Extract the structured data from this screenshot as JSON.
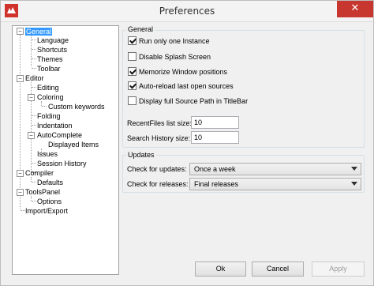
{
  "window": {
    "title": "Preferences",
    "close_glyph": "✕"
  },
  "tree": {
    "items": [
      {
        "label": "General",
        "selected": true
      },
      {
        "label": "Language"
      },
      {
        "label": "Shortcuts"
      },
      {
        "label": "Themes"
      },
      {
        "label": "Toolbar"
      },
      {
        "label": "Editor"
      },
      {
        "label": "Editing"
      },
      {
        "label": "Coloring"
      },
      {
        "label": "Custom keywords"
      },
      {
        "label": "Folding"
      },
      {
        "label": "Indentation"
      },
      {
        "label": "AutoComplete"
      },
      {
        "label": "Displayed Items"
      },
      {
        "label": "Issues"
      },
      {
        "label": "Session History"
      },
      {
        "label": "Compiler"
      },
      {
        "label": "Defaults"
      },
      {
        "label": "ToolsPanel"
      },
      {
        "label": "Options"
      },
      {
        "label": "Import/Export"
      }
    ],
    "expander_glyph": "−"
  },
  "general": {
    "title": "General",
    "checkboxes": [
      {
        "label": "Run only one Instance",
        "checked": true
      },
      {
        "label": "Disable Splash Screen",
        "checked": false
      },
      {
        "label": "Memorize Window positions",
        "checked": true
      },
      {
        "label": "Auto-reload last open sources",
        "checked": true
      },
      {
        "label": "Display full Source Path in TitleBar",
        "checked": false
      }
    ],
    "recent_files_label": "RecentFiles list size:",
    "recent_files_value": "10",
    "search_history_label": "Search History size:",
    "search_history_value": "10"
  },
  "updates": {
    "title": "Updates",
    "check_updates_label": "Check for updates:",
    "check_updates_value": "Once a week",
    "check_releases_label": "Check for releases:",
    "check_releases_value": "Final releases"
  },
  "buttons": {
    "ok": "Ok",
    "cancel": "Cancel",
    "apply": "Apply"
  }
}
